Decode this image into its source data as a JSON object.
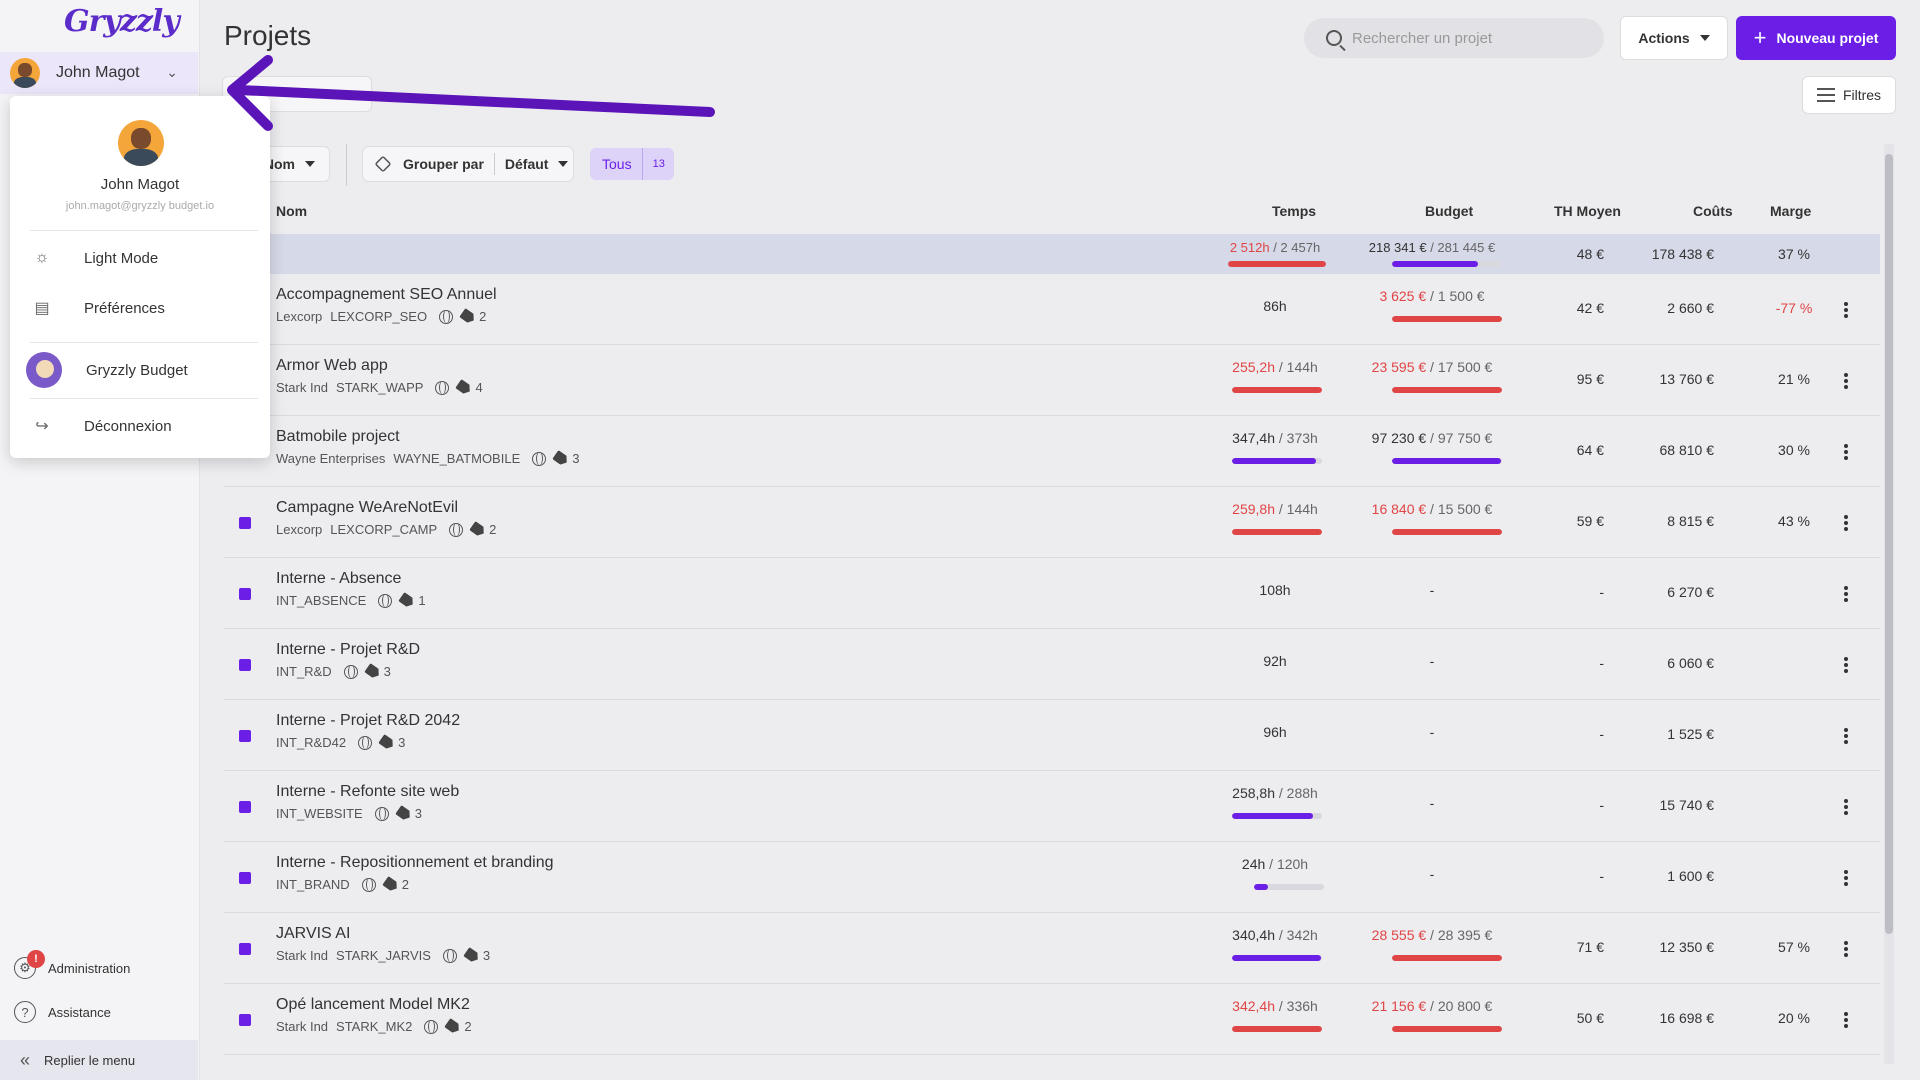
{
  "sidebar": {
    "logo": "Gryzzly",
    "user_name": "John Magot",
    "admin_label": "Administration",
    "admin_badge": "!",
    "help_label": "Assistance",
    "collapse_label": "Replier le menu"
  },
  "user_menu": {
    "name": "John Magot",
    "email": "john.magot@gryzzly budget.io",
    "items": [
      {
        "label": "Light Mode",
        "icon": "sun-icon"
      },
      {
        "label": "Préférences",
        "icon": "preferences-icon"
      },
      {
        "label": "Gryzzly Budget",
        "icon": "gryzzly-mascot-icon"
      },
      {
        "label": "Déconnexion",
        "icon": "logout-icon"
      }
    ]
  },
  "header": {
    "title": "Projets",
    "search_placeholder": "Rechercher un projet",
    "actions_label": "Actions",
    "new_project_label": "Nouveau projet",
    "filters_label": "Filtres"
  },
  "toolbar": {
    "sort_label": "Nom",
    "group_label": "Grouper par",
    "group_value": "Défaut",
    "filter_label": "Tous",
    "filter_count": "13"
  },
  "columns": {
    "name": "Nom",
    "time": "Temps",
    "budget": "Budget",
    "avg_rate": "TH Moyen",
    "costs": "Coûts",
    "margin": "Marge"
  },
  "totals": {
    "time_used": "2 512h",
    "time_total": "2 457h",
    "time_fraction": 1.0,
    "budget_used": "218 341 €",
    "budget_total": "281 445 €",
    "budget_fraction": 0.78,
    "avg_rate": "48 €",
    "costs": "178 438 €",
    "margin": "37 %"
  },
  "projects": [
    {
      "name": "Accompagnement SEO Annuel",
      "client": "Lexcorp",
      "code": "LEXCORP_SEO",
      "tags": "2",
      "time_used": "86h",
      "time_total": "",
      "time_fraction": null,
      "time_over": false,
      "budget_used": "3 625 €",
      "budget_total": "1 500 €",
      "budget_fraction": 1.0,
      "budget_over": true,
      "avg_rate": "42 €",
      "costs": "2 660 €",
      "margin": "-77 %",
      "margin_negative": true
    },
    {
      "name": "Armor Web app",
      "client": "Stark Ind",
      "code": "STARK_WAPP",
      "tags": "4",
      "time_used": "255,2h",
      "time_total": "144h",
      "time_fraction": 1.0,
      "time_over": true,
      "budget_used": "23 595 €",
      "budget_total": "17 500 €",
      "budget_fraction": 1.0,
      "budget_over": true,
      "avg_rate": "95 €",
      "costs": "13 760 €",
      "margin": "21 %",
      "margin_negative": false
    },
    {
      "name": "Batmobile project",
      "client": "Wayne Enterprises",
      "code": "WAYNE_BATMOBILE",
      "tags": "3",
      "time_used": "347,4h",
      "time_total": "373h",
      "time_fraction": 0.93,
      "time_over": false,
      "budget_used": "97 230 €",
      "budget_total": "97 750 €",
      "budget_fraction": 0.99,
      "budget_over": false,
      "avg_rate": "64 €",
      "costs": "68 810 €",
      "margin": "30 %",
      "margin_negative": false
    },
    {
      "name": "Campagne WeAreNotEvil",
      "client": "Lexcorp",
      "code": "LEXCORP_CAMP",
      "tags": "2",
      "time_used": "259,8h",
      "time_total": "144h",
      "time_fraction": 1.0,
      "time_over": true,
      "budget_used": "16 840 €",
      "budget_total": "15 500 €",
      "budget_fraction": 1.0,
      "budget_over": true,
      "avg_rate": "59 €",
      "costs": "8 815 €",
      "margin": "43 %",
      "margin_negative": false
    },
    {
      "name": "Interne - Absence",
      "client": "",
      "code": "INT_ABSENCE",
      "tags": "1",
      "time_used": "108h",
      "time_total": "",
      "time_fraction": null,
      "time_over": false,
      "budget_used": "-",
      "budget_total": "",
      "budget_fraction": null,
      "budget_over": false,
      "avg_rate": "-",
      "costs": "6 270 €",
      "margin": "",
      "margin_negative": false
    },
    {
      "name": "Interne - Projet R&D",
      "client": "",
      "code": "INT_R&D",
      "tags": "3",
      "time_used": "92h",
      "time_total": "",
      "time_fraction": null,
      "time_over": false,
      "budget_used": "-",
      "budget_total": "",
      "budget_fraction": null,
      "budget_over": false,
      "avg_rate": "-",
      "costs": "6 060 €",
      "margin": "",
      "margin_negative": false
    },
    {
      "name": "Interne - Projet R&D 2042",
      "client": "",
      "code": "INT_R&D42",
      "tags": "3",
      "time_used": "96h",
      "time_total": "",
      "time_fraction": null,
      "time_over": false,
      "budget_used": "-",
      "budget_total": "",
      "budget_fraction": null,
      "budget_over": false,
      "avg_rate": "-",
      "costs": "1 525 €",
      "margin": "",
      "margin_negative": false
    },
    {
      "name": "Interne - Refonte site web",
      "client": "",
      "code": "INT_WEBSITE",
      "tags": "3",
      "time_used": "258,8h",
      "time_total": "288h",
      "time_fraction": 0.9,
      "time_over": false,
      "budget_used": "-",
      "budget_total": "",
      "budget_fraction": null,
      "budget_over": false,
      "avg_rate": "-",
      "costs": "15 740 €",
      "margin": "",
      "margin_negative": false
    },
    {
      "name": "Interne - Repositionnement et branding",
      "client": "",
      "code": "INT_BRAND",
      "tags": "2",
      "time_used": "24h",
      "time_total": "120h",
      "time_fraction": 0.2,
      "time_over": false,
      "budget_used": "-",
      "budget_total": "",
      "budget_fraction": null,
      "budget_over": false,
      "avg_rate": "-",
      "costs": "1 600 €",
      "margin": "",
      "margin_negative": false
    },
    {
      "name": "JARVIS AI",
      "client": "Stark Ind",
      "code": "STARK_JARVIS",
      "tags": "3",
      "time_used": "340,4h",
      "time_total": "342h",
      "time_fraction": 0.99,
      "time_over": false,
      "budget_used": "28 555 €",
      "budget_total": "28 395 €",
      "budget_fraction": 1.0,
      "budget_over": true,
      "avg_rate": "71 €",
      "costs": "12 350 €",
      "margin": "57 %",
      "margin_negative": false
    },
    {
      "name": "Opé lancement Model MK2",
      "client": "Stark Ind",
      "code": "STARK_MK2",
      "tags": "2",
      "time_used": "342,4h",
      "time_total": "336h",
      "time_fraction": 1.0,
      "time_over": true,
      "budget_used": "21 156 €",
      "budget_total": "20 800 €",
      "budget_fraction": 1.0,
      "budget_over": true,
      "avg_rate": "50 €",
      "costs": "16 698 €",
      "margin": "20 %",
      "margin_negative": false
    }
  ],
  "colors": {
    "accent": "#6b1ee6",
    "over": "#e04545",
    "annotation_arrow": "#5a14b8"
  }
}
